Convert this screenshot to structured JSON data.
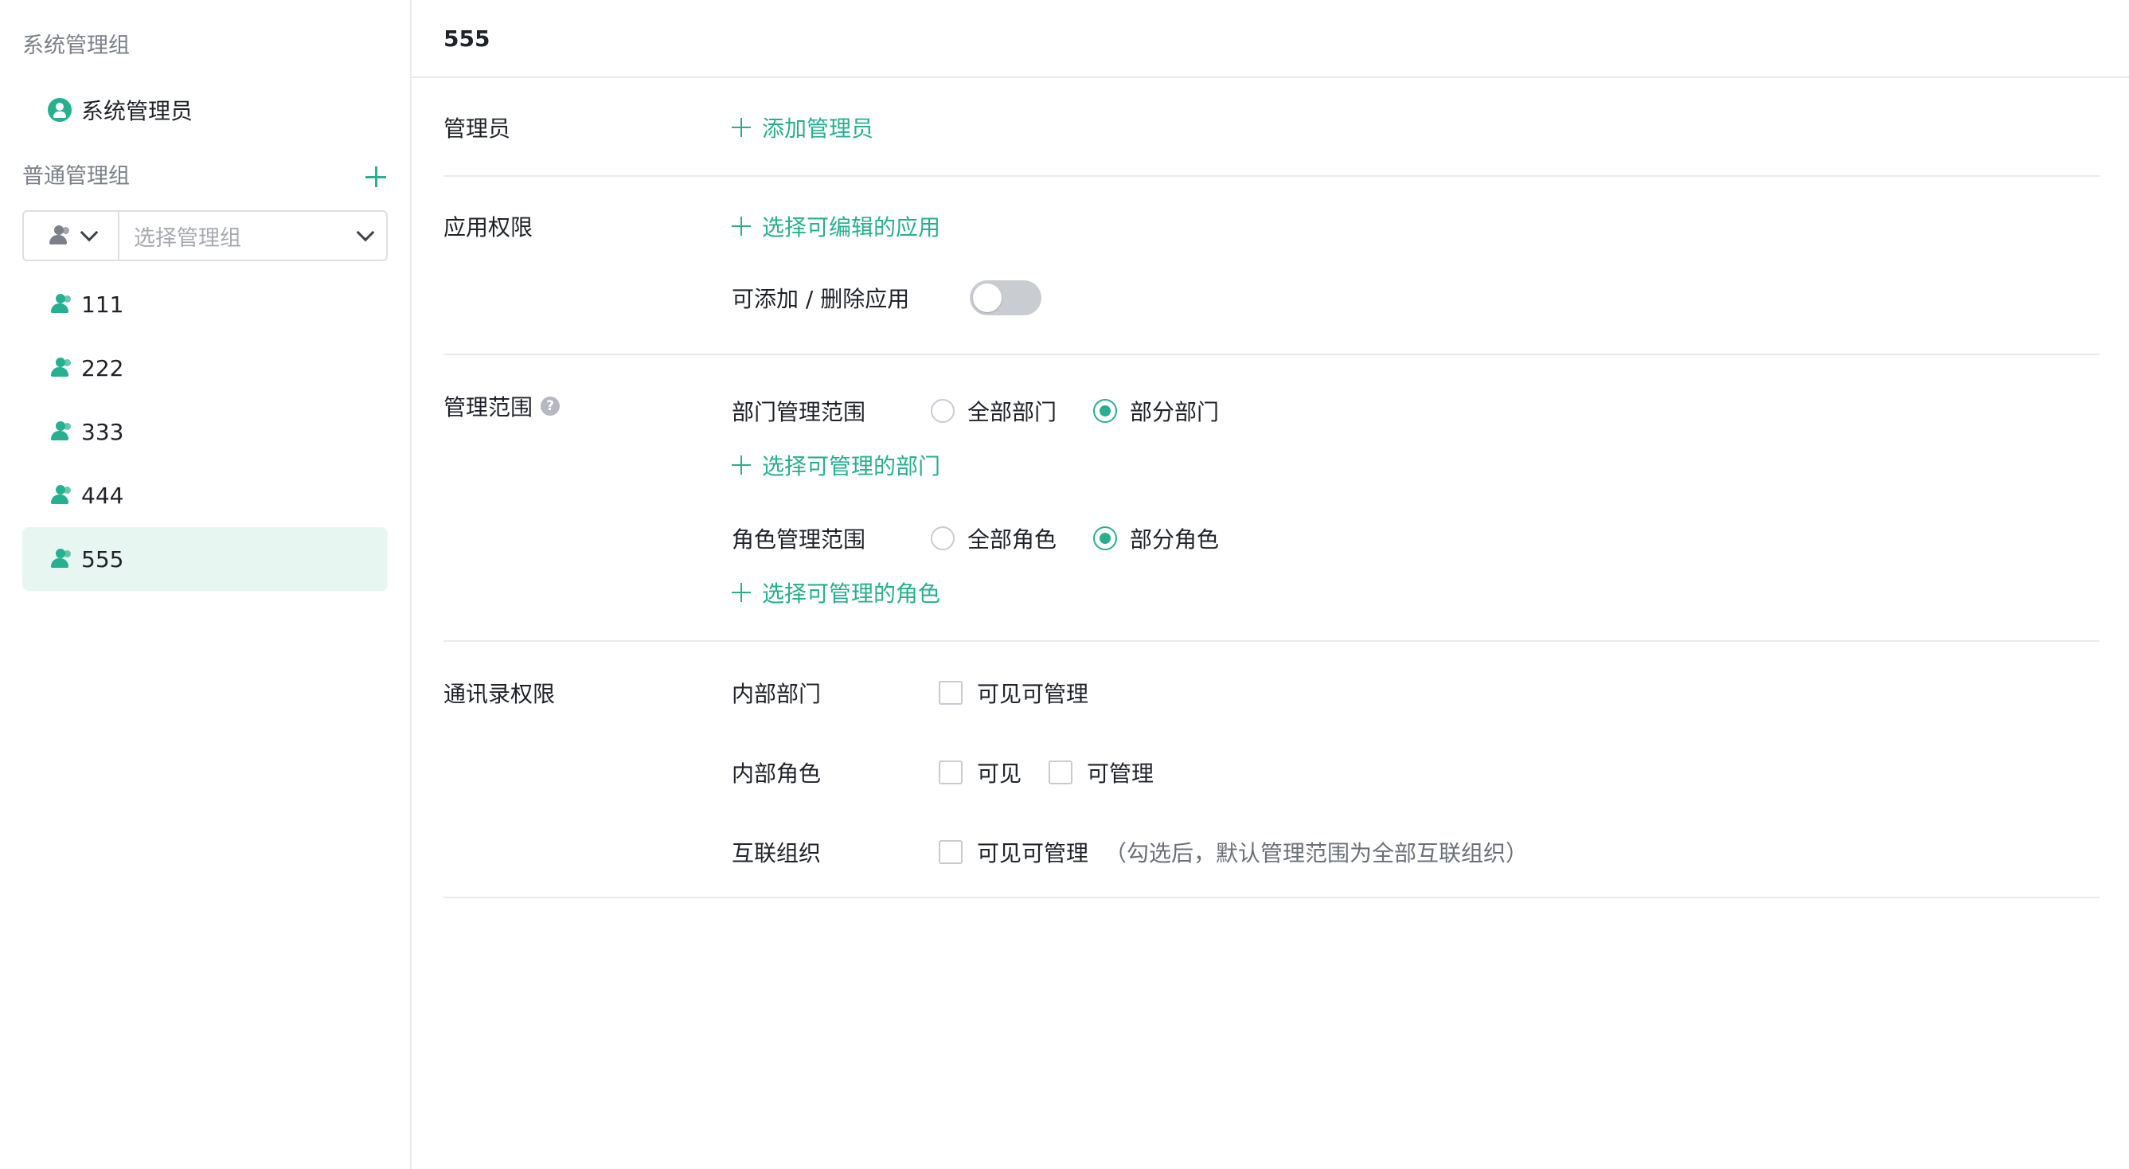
{
  "sidebar": {
    "system_group_title": "系统管理组",
    "system_admin_label": "系统管理员",
    "normal_group_title": "普通管理组",
    "group_select_placeholder": "选择管理组",
    "groups": [
      {
        "label": "111"
      },
      {
        "label": "222"
      },
      {
        "label": "333"
      },
      {
        "label": "444"
      },
      {
        "label": "555",
        "active": true
      }
    ]
  },
  "main": {
    "title": "555",
    "admins": {
      "label": "管理员",
      "add_link": "添加管理员"
    },
    "app_permission": {
      "label": "应用权限",
      "select_link": "选择可编辑的应用",
      "toggle_label": "可添加 / 删除应用",
      "toggle_on": false
    },
    "scope": {
      "label": "管理范围",
      "help": "?",
      "dept": {
        "label": "部门管理范围",
        "options": [
          "全部部门",
          "部分部门"
        ],
        "selected": "部分部门",
        "link": "选择可管理的部门"
      },
      "role": {
        "label": "角色管理范围",
        "options": [
          "全部角色",
          "部分角色"
        ],
        "selected": "部分角色",
        "link": "选择可管理的角色"
      }
    },
    "contacts": {
      "label": "通讯录权限",
      "internal_dept": {
        "label": "内部部门",
        "opt1": "可见可管理"
      },
      "internal_role": {
        "label": "内部角色",
        "opt1": "可见",
        "opt2": "可管理"
      },
      "interconnect": {
        "label": "互联组织",
        "opt1": "可见可管理",
        "note": "（勾选后，默认管理范围为全部互联组织）"
      }
    }
  },
  "colors": {
    "accent": "#26b08f",
    "selected_bg": "#e7f6f1"
  }
}
